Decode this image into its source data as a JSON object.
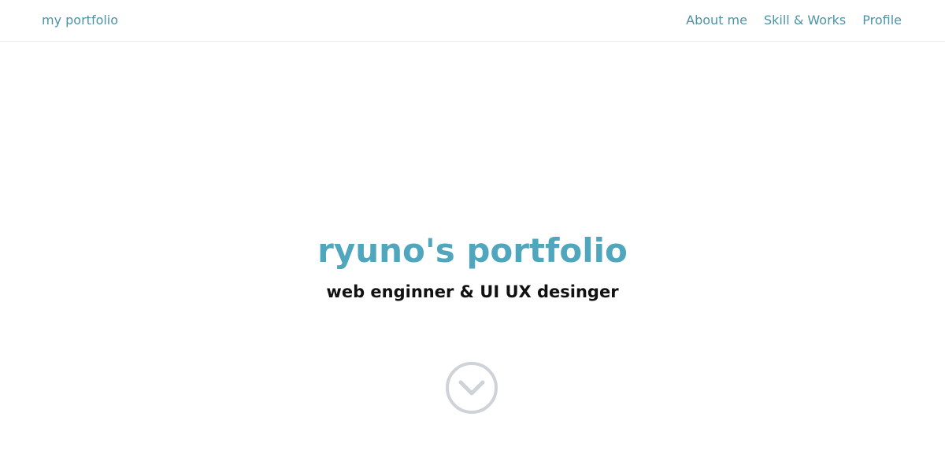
{
  "header": {
    "brand": "my portfolio",
    "nav": [
      {
        "label": "About me"
      },
      {
        "label": "Skill & Works"
      },
      {
        "label": "Profile"
      }
    ]
  },
  "hero": {
    "title": "ryuno's portfolio",
    "subtitle": "web enginner & UI UX desinger",
    "scroll_icon": "chevron-down-circle-icon"
  },
  "colors": {
    "accent": "#4fa6bd",
    "nav_text": "#4b93a6",
    "subtitle_text": "#111111",
    "icon_gray": "#cfd3d8"
  }
}
